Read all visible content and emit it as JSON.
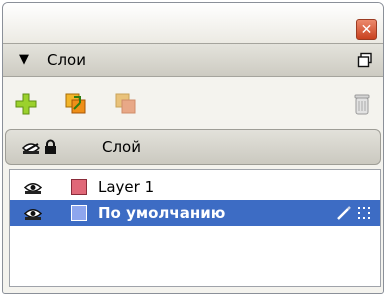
{
  "panel": {
    "title": "Слои"
  },
  "table": {
    "header_label": "Слой"
  },
  "layers": [
    {
      "name": "Layer 1",
      "color": "#e06878",
      "selected": false
    },
    {
      "name": "По умолчанию",
      "color": "#8ea6ee",
      "selected": true
    }
  ],
  "colors": {
    "accent": "#3d6cc4",
    "close_button": "#d9542d"
  },
  "icons": {
    "toolbar": [
      "add-layer-icon",
      "move-to-layer-icon",
      "copy-to-layer-icon",
      "delete-layer-icon"
    ],
    "header": [
      "visibility-eye-icon",
      "lock-icon"
    ],
    "window": [
      "close-icon",
      "panel-menu-icon"
    ]
  }
}
